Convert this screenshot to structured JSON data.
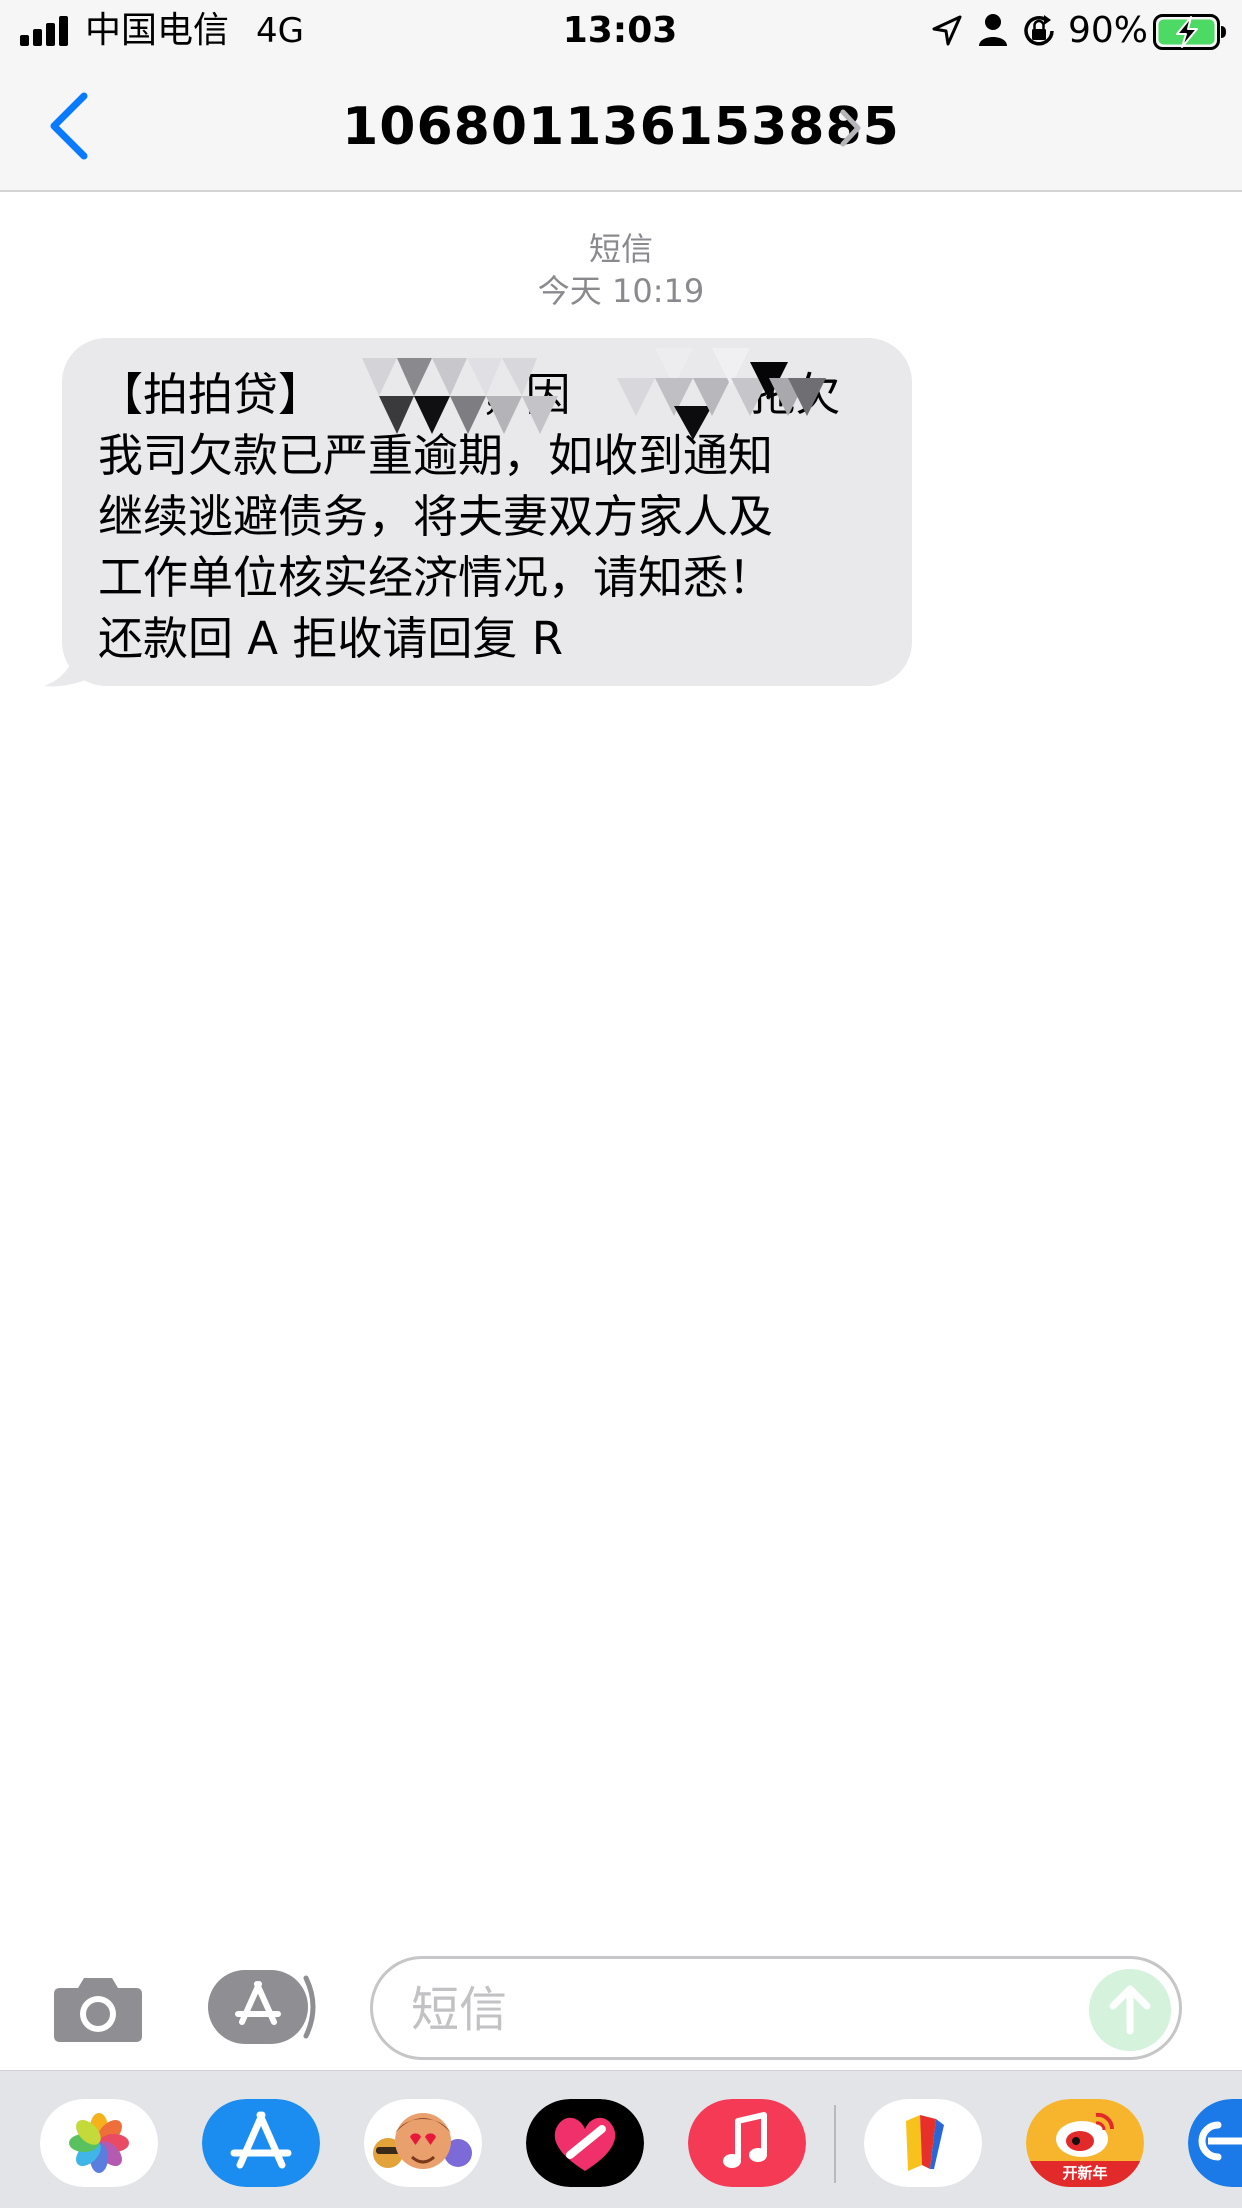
{
  "status_bar": {
    "carrier": "中国电信",
    "network": "4G",
    "time": "13:03",
    "battery": "90%"
  },
  "header": {
    "contact": "106801136153885"
  },
  "thread": {
    "service": "短信",
    "timestamp": "今天 10:19"
  },
  "message": {
    "lines": [
      "【拍拍贷】　　　　，因　　　　拖欠",
      "我司欠款已严重逾期，如收到通知",
      "继续逃避债务，将夫妻双方家人及",
      "工作单位核实经济情况，请知悉！",
      "还款回 A 拒收请回复 R"
    ]
  },
  "compose": {
    "placeholder": "短信"
  },
  "app_drawer": {
    "apps": [
      "photos-icon",
      "app-store-icon",
      "memoji-icon",
      "digital-touch-icon",
      "music-icon",
      "app-icon",
      "weibo-icon",
      "more-app-icon"
    ],
    "weibo_badge": "开新年"
  },
  "colors": {
    "accent": "#0a7aff",
    "bubble": "#e9e9eb",
    "bar": "#f6f6f6"
  }
}
